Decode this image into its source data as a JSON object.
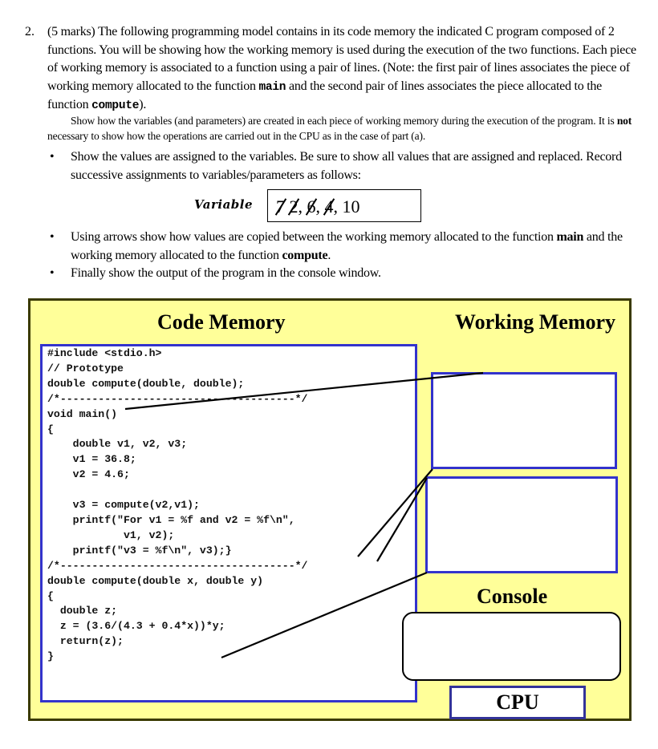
{
  "question": {
    "number": "2.",
    "marks": "(5 marks)",
    "intro_a": "The following programming model contains in its code memory the indicated C program composed of 2 functions.  You will be showing how the working memory is used during the execution of the two functions. Each piece of working memory is associated to a function using a pair of lines. (Note: the first pair of lines associates the piece of working memory allocated to the function ",
    "intro_main": "main",
    "intro_b": " and the second pair of lines associates the piece allocated to the function ",
    "intro_compute": "compute",
    "intro_c": ").",
    "note_a": "Show how the variables (and parameters) are created in each piece of working memory during the execution of the program. It is ",
    "note_not": "not",
    "note_b": " necessary to show how the operations are carried out in the CPU as in the case of part (a)."
  },
  "bullets": {
    "symbol": "•",
    "b1": "Show the values are assigned to the variables. Be sure to show all values that are assigned and replaced. Record successive assignments to variables/parameters as follows:",
    "b2_a": "Using arrows show how values are copied between the working memory allocated to the function ",
    "b2_main": "main",
    "b2_b": " and the working memory allocated to the function ",
    "b2_compute": "compute",
    "b2_c": ".",
    "b3": "Finally show the output of the program in the console window."
  },
  "example": {
    "label": "Variable",
    "struck_values": [
      "7",
      "2",
      "6",
      "4"
    ],
    "separator": ", ",
    "final_value": "10"
  },
  "diagram": {
    "code_memory_title": "Code Memory",
    "working_memory_title": "Working Memory",
    "console_title": "Console",
    "cpu_label": "CPU",
    "code": "#include <stdio.h>\n// Prototype\ndouble compute(double, double);\n/*-------------------------------------*/\nvoid main()\n{\n    double v1, v2, v3;\n    v1 = 36.8;\n    v2 = 4.6;\n\n    v3 = compute(v2,v1);\n    printf(\"For v1 = %f and v2 = %f\\n\",\n            v1, v2);\n    printf(\"v3 = %f\\n\", v3);}\n/*-------------------------------------*/\ndouble compute(double x, double y)\n{\n  double z;\n  z = (3.6/(4.3 + 0.4*x))*y;\n  return(z);\n}",
    "console_output": "",
    "colors": {
      "frame_fill": "#ffff99",
      "frame_border": "#3a3a00",
      "box_border": "#3333cc"
    }
  }
}
